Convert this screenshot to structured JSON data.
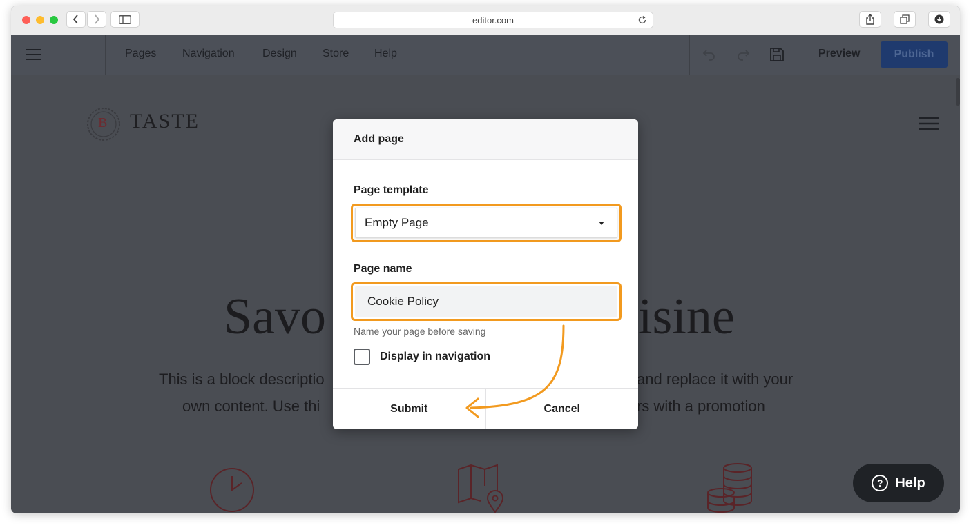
{
  "browser": {
    "url": "editor.com"
  },
  "editor": {
    "nav": [
      "Pages",
      "Navigation",
      "Design",
      "Store",
      "Help"
    ],
    "preview_label": "Preview",
    "publish_label": "Publish"
  },
  "site": {
    "brand_letter": "B",
    "brand_name": "TASTE",
    "headline_left": "Savo",
    "headline_right": "isine",
    "desc_line1_left": "This is a block descriptio",
    "desc_line1_right": "and replace it with your",
    "desc_line2_left": "own content. Use thi",
    "desc_line2_right": "rs with a promotion"
  },
  "help_widget": {
    "label": "Help"
  },
  "modal": {
    "title": "Add page",
    "template_label": "Page template",
    "template_value": "Empty Page",
    "name_label": "Page name",
    "name_value": "Cookie Policy",
    "name_hint": "Name your page before saving",
    "checkbox_label": "Display in navigation",
    "submit_label": "Submit",
    "cancel_label": "Cancel"
  },
  "colors": {
    "highlight": "#f29a1f",
    "publish_bg": "#1f3a6e",
    "overlay": "#4a4d53",
    "icon_accent": "#7a2f33"
  }
}
